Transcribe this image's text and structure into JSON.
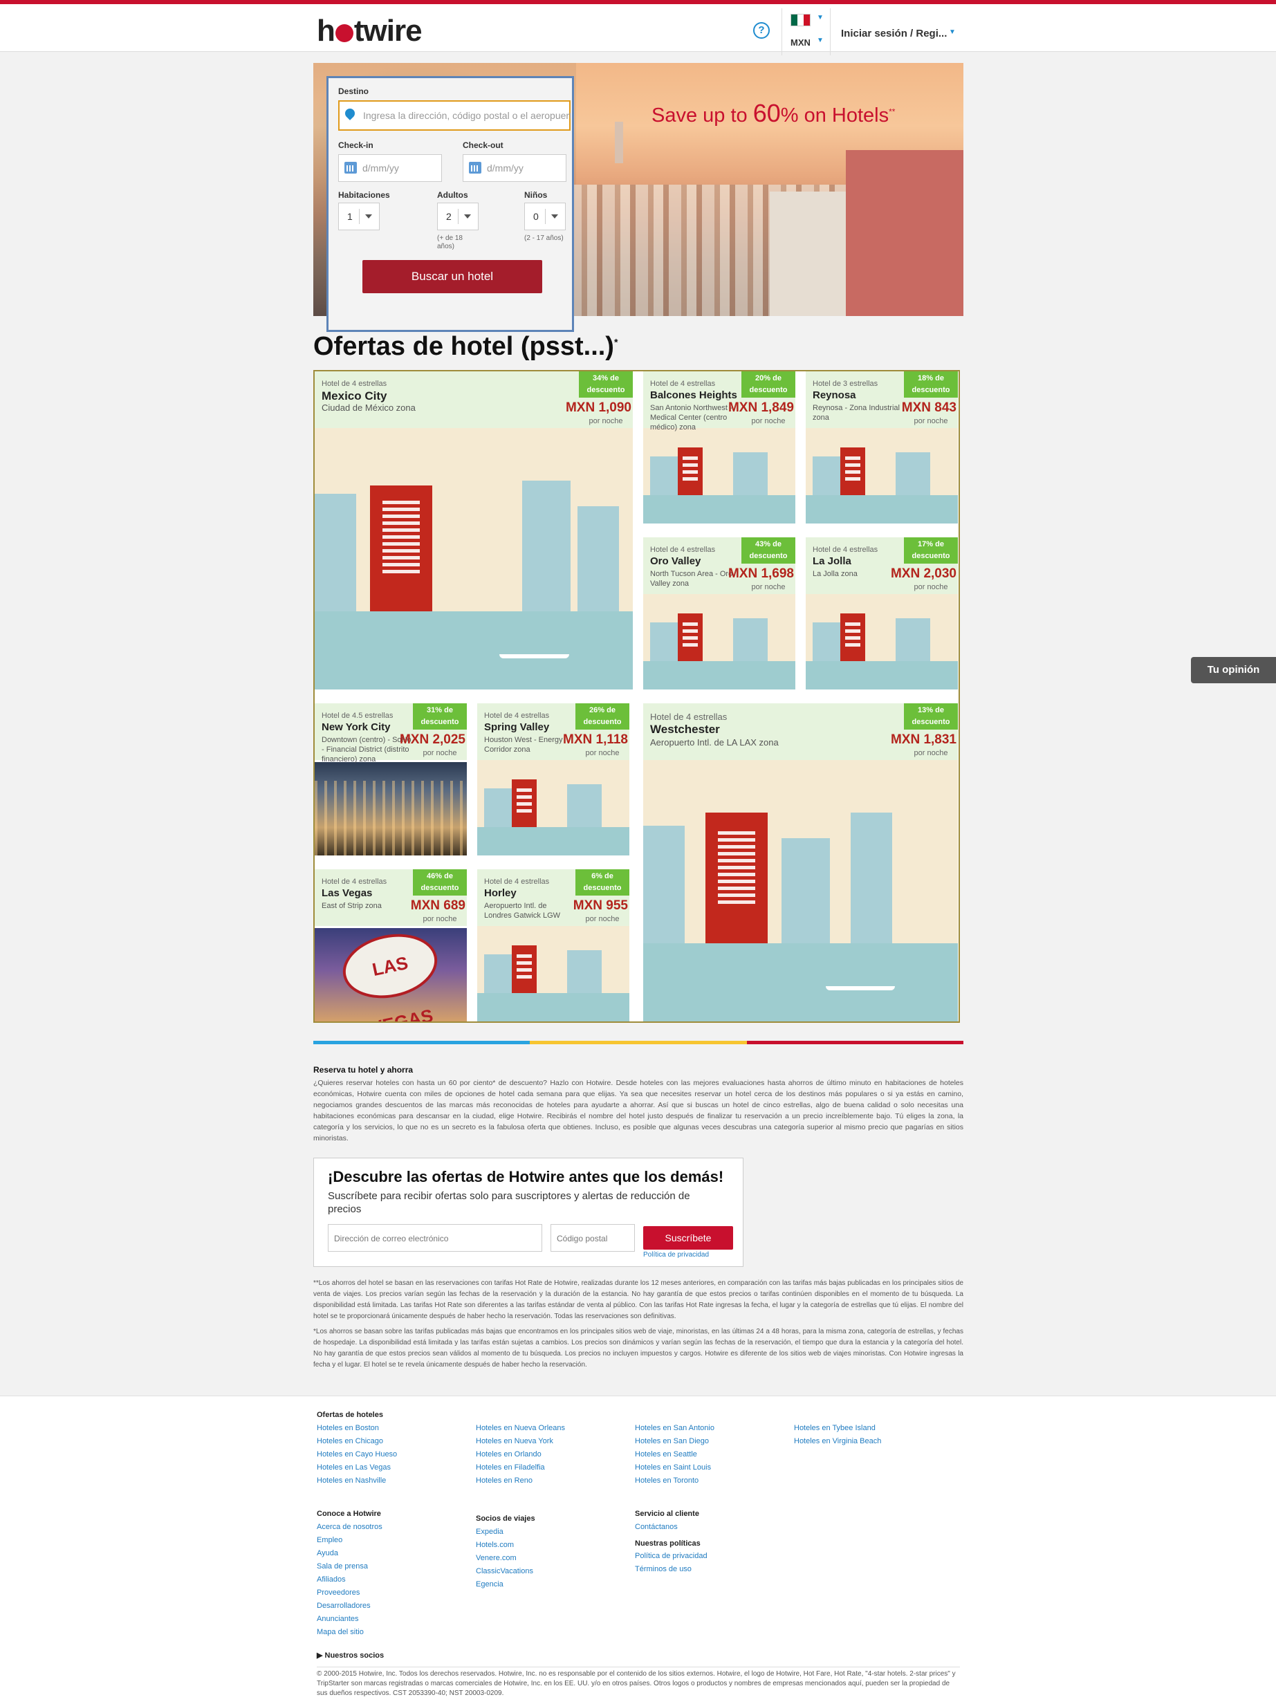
{
  "header": {
    "logo": "hotwire",
    "help_icon": "?",
    "currency": "MXN",
    "signin": "Iniciar sesión / Regi...",
    "flag_colors": [
      "#006847",
      "#ffffff",
      "#ce1126"
    ]
  },
  "hero": {
    "promo_prefix": "Save up to ",
    "promo_value": "60",
    "promo_suffix": "% on Hotels",
    "promo_mark": "**"
  },
  "search": {
    "destination_label": "Destino",
    "destination_placeholder": "Ingresa la dirección, código postal o el aeropuerto",
    "checkin_label": "Check-in",
    "checkout_label": "Check-out",
    "date_placeholder": "d/mm/yy",
    "rooms_label": "Habitaciones",
    "adults_label": "Adultos",
    "children_label": "Niños",
    "rooms_value": "1",
    "adults_value": "2",
    "children_value": "0",
    "adults_note": "(+ de 18 años)",
    "children_note": "(2 - 17 años)",
    "button": "Buscar un hotel"
  },
  "deals": {
    "title": "Ofertas de hotel (psst...)",
    "title_mark": "*",
    "per_night": "por noche",
    "cards": [
      {
        "stars": "Hotel de 4 estrellas",
        "city": "Mexico City",
        "zone": "Ciudad de México zona",
        "discount": "34% de descuento",
        "price": "MXN 1,090"
      },
      {
        "stars": "Hotel de 4 estrellas",
        "city": "Balcones Heights",
        "zone": "San Antonio Northwest - Medical Center (centro médico) zona",
        "discount": "20% de descuento",
        "price": "MXN 1,849"
      },
      {
        "stars": "Hotel de 3 estrellas",
        "city": "Reynosa",
        "zone": "Reynosa - Zona Industrial zona",
        "discount": "18% de descuento",
        "price": "MXN 843"
      },
      {
        "stars": "Hotel de 4 estrellas",
        "city": "Oro Valley",
        "zone": "North Tucson Area - Oro Valley zona",
        "discount": "43% de descuento",
        "price": "MXN 1,698"
      },
      {
        "stars": "Hotel de 4 estrellas",
        "city": "La Jolla",
        "zone": "La Jolla zona",
        "discount": "17% de descuento",
        "price": "MXN 2,030"
      },
      {
        "stars": "Hotel de 4.5 estrellas",
        "city": "New York City",
        "zone": "Downtown (centro) - SoHo - Financial District (distrito financiero) zona",
        "discount": "31% de descuento",
        "price": "MXN 2,025"
      },
      {
        "stars": "Hotel de 4 estrellas",
        "city": "Spring Valley",
        "zone": "Houston West - Energy Corridor zona",
        "discount": "26% de descuento",
        "price": "MXN 1,118"
      },
      {
        "stars": "Hotel de 4 estrellas",
        "city": "Westchester",
        "zone": "Aeropuerto Intl. de LA LAX zona",
        "discount": "13% de descuento",
        "price": "MXN 1,831"
      },
      {
        "stars": "Hotel de 4 estrellas",
        "city": "Las Vegas",
        "zone": "East of Strip zona",
        "discount": "46% de descuento",
        "price": "MXN 689"
      },
      {
        "stars": "Hotel de 4 estrellas",
        "city": "Horley",
        "zone": "Aeropuerto Intl. de Londres Gatwick LGW",
        "discount": "6% de descuento",
        "price": "MXN 955"
      }
    ],
    "vegas_sign": "LAS VEGAS"
  },
  "colorbar": [
    "#29a3e0",
    "#f7c531",
    "#c8102e"
  ],
  "seo": {
    "title": "Reserva tu hotel y ahorra",
    "text": "¿Quieres reservar hoteles con hasta un 60 por ciento* de descuento? Hazlo con Hotwire. Desde hoteles con las mejores evaluaciones hasta ahorros de último minuto en habitaciones de hoteles económicas, Hotwire cuenta con miles de opciones de hotel cada semana para que elijas. Ya sea que necesites reservar un hotel cerca de los destinos más populares o si ya estás en camino, negociamos grandes descuentos de las marcas más reconocidas de hoteles para ayudarte a ahorrar. Así que si buscas un hotel de cinco estrellas, algo de buena calidad o solo necesitas una habitaciones económicas para descansar en la ciudad, elige Hotwire. Recibirás el nombre del hotel justo después de finalizar tu reservación a un precio increíblemente bajo. Tú eliges la zona, la categoría y los servicios, lo que no es un secreto es la fabulosa oferta que obtienes. Incluso, es posible que algunas veces descubras una categoría superior al mismo precio que pagarías en sitios minoristas."
  },
  "subscribe": {
    "title": "¡Descubre las ofertas de Hotwire antes que los demás!",
    "text": "Suscríbete para recibir ofertas solo para suscriptores y alertas de reducción de precios",
    "email_placeholder": "Dirección de correo electrónico",
    "zip_placeholder": "Código postal",
    "button": "Suscríbete",
    "privacy": "Política de privacidad"
  },
  "legal": {
    "p1": "**Los ahorros del hotel se basan en las reservaciones con tarifas Hot Rate de Hotwire, realizadas durante los 12 meses anteriores, en comparación con las tarifas más bajas publicadas en los principales sitios de venta de viajes. Los precios varían según las fechas de la reservación y la duración de la estancia. No hay garantía de que estos precios o tarifas continúen disponibles en el momento de tu búsqueda. La disponibilidad está limitada. Las tarifas Hot Rate son diferentes a las tarifas estándar de venta al público. Con las tarifas Hot Rate ingresas la fecha, el lugar y la categoría de estrellas que tú elijas. El nombre del hotel se te proporcionará únicamente después de haber hecho la reservación. Todas las reservaciones son definitivas.",
    "p2": "*Los ahorros se basan sobre las tarifas publicadas más bajas que encontramos en los principales sitios web de viaje, minoristas, en las últimas 24 a 48 horas, para la misma zona, categoría de estrellas, y fechas de hospedaje. La disponibilidad está limitada y las tarifas están sujetas a cambios. Los precios son dinámicos y varían según las fechas de la reservación, el tiempo que dura la estancia y la categoría del hotel. No hay garantía de que estos precios sean válidos al momento de tu búsqueda. Los precios no incluyen impuestos y cargos. Hotwire es diferente de los sitios web de viajes minoristas. Con Hotwire ingresas la fecha y el lugar. El hotel se te revela únicamente después de haber hecho la reservación."
  },
  "footer": {
    "deals_heading": "Ofertas de hoteles",
    "deal_cols": [
      [
        "Hoteles en Boston",
        "Hoteles en Chicago",
        "Hoteles en Cayo Hueso",
        "Hoteles en Las Vegas",
        "Hoteles en Nashville"
      ],
      [
        "Hoteles en Nueva Orleans",
        "Hoteles en Nueva York",
        "Hoteles en Orlando",
        "Hoteles en Filadelfia",
        "Hoteles en Reno"
      ],
      [
        "Hoteles en San Antonio",
        "Hoteles en San Diego",
        "Hoteles en Seattle",
        "Hoteles en Saint Louis",
        "Hoteles en Toronto"
      ],
      [
        "Hoteles en Tybee Island",
        "Hoteles en Virginia Beach"
      ]
    ],
    "about_heading": "Conoce a Hotwire",
    "about_links": [
      "Acerca de nosotros",
      "Empleo",
      "Ayuda",
      "Sala de prensa",
      "Afiliados",
      "Proveedores",
      "Desarrolladores",
      "Anunciantes",
      "Mapa del sitio"
    ],
    "partners_heading": "Socios de viajes",
    "partners_links": [
      "Expedia",
      "Hotels.com",
      "Venere.com",
      "ClassicVacations",
      "Egencia"
    ],
    "service_heading": "Servicio al cliente",
    "service_links": [
      "Contáctanos"
    ],
    "policies_heading": "Nuestras políticas",
    "policies_links": [
      "Política de privacidad",
      "Términos de uso"
    ],
    "partners_toggle": "Nuestros socios",
    "copyright": "© 2000-2015 Hotwire, Inc. Todos los derechos reservados. Hotwire, Inc. no es responsable por el contenido de los sitios externos. Hotwire, el logo de Hotwire, Hot Fare, Hot Rate, \"4-star hotels. 2-star prices\" y TripStarter son marcas registradas o marcas comerciales de Hotwire, Inc. en los EE. UU. y/o en otros países. Otros logos o productos y nombres de empresas mencionados aquí, pueden ser la propiedad de sus dueños respectivos. CST 2053390-40; NST 20003-0209."
  },
  "feedback": "Tu opinión"
}
